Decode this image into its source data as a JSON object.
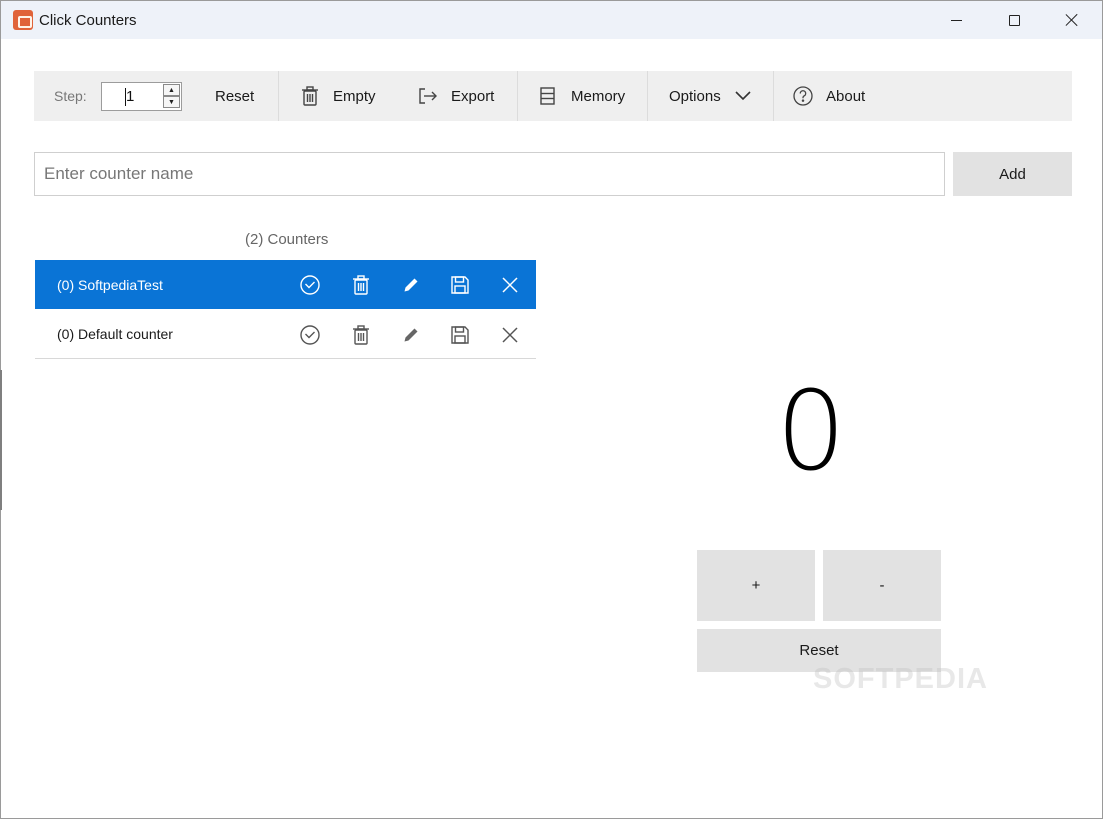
{
  "window": {
    "title": "Click Counters"
  },
  "toolbar": {
    "step_label": "Step:",
    "step_value": "1",
    "reset_label": "Reset",
    "empty_label": "Empty",
    "export_label": "Export",
    "memory_label": "Memory",
    "options_label": "Options",
    "about_label": "About"
  },
  "add_row": {
    "placeholder": "Enter counter name",
    "add_label": "Add"
  },
  "counters": {
    "header": "(2) Counters",
    "items": [
      {
        "label": "(0) SoftpediaTest",
        "selected": true
      },
      {
        "label": "(0) Default counter",
        "selected": false
      }
    ]
  },
  "display": {
    "value": "0",
    "plus_label": "+",
    "minus_label": "-",
    "reset_label": "Reset"
  },
  "watermark": "SOFTPEDIA",
  "colors": {
    "accent": "#0a74d6",
    "toolbar_bg": "#efefef",
    "button_bg": "#e2e2e2",
    "titlebar_bg": "#eef2f9"
  }
}
